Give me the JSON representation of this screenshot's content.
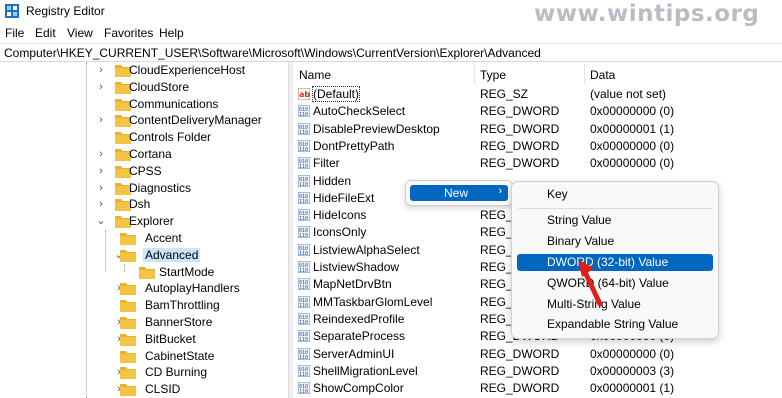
{
  "window": {
    "title": "Registry Editor",
    "watermark": "www.wintips.org",
    "icon": "registry-editor-icon"
  },
  "menu": [
    "File",
    "Edit",
    "View",
    "Favorites",
    "Help"
  ],
  "address": "Computer\\HKEY_CURRENT_USER\\Software\\Microsoft\\Windows\\CurrentVersion\\Explorer\\Advanced",
  "tree": [
    {
      "label": "CloudExperienceHost",
      "expander": "collapsed"
    },
    {
      "label": "CloudStore",
      "expander": "collapsed"
    },
    {
      "label": "Communications",
      "expander": "none"
    },
    {
      "label": "ContentDeliveryManager",
      "expander": "collapsed"
    },
    {
      "label": "Controls Folder",
      "expander": "none"
    },
    {
      "label": "Cortana",
      "expander": "collapsed"
    },
    {
      "label": "CPSS",
      "expander": "collapsed"
    },
    {
      "label": "Diagnostics",
      "expander": "collapsed"
    },
    {
      "label": "Dsh",
      "expander": "collapsed"
    },
    {
      "label": "Explorer",
      "expander": "expanded"
    },
    {
      "label": "Accent",
      "expander": "none"
    },
    {
      "label": "Advanced",
      "expander": "expanded",
      "selected": true
    },
    {
      "label": "StartMode",
      "expander": "none"
    },
    {
      "label": "AutoplayHandlers",
      "expander": "collapsed"
    },
    {
      "label": "BamThrottling",
      "expander": "none"
    },
    {
      "label": "BannerStore",
      "expander": "collapsed"
    },
    {
      "label": "BitBucket",
      "expander": "collapsed"
    },
    {
      "label": "CabinetState",
      "expander": "none"
    },
    {
      "label": "CD Burning",
      "expander": "collapsed"
    },
    {
      "label": "CLSID",
      "expander": "collapsed"
    }
  ],
  "list": {
    "headers": {
      "name": "Name",
      "type": "Type",
      "data": "Data"
    },
    "rows": [
      {
        "name": "(Default)",
        "type": "REG_SZ",
        "data": "(value not set)",
        "icon": "string-value-icon"
      },
      {
        "name": "AutoCheckSelect",
        "type": "REG_DWORD",
        "data": "0x00000000 (0)",
        "icon": "binary-value-icon"
      },
      {
        "name": "DisablePreviewDesktop",
        "type": "REG_DWORD",
        "data": "0x00000001 (1)",
        "icon": "binary-value-icon"
      },
      {
        "name": "DontPrettyPath",
        "type": "REG_DWORD",
        "data": "0x00000000 (0)",
        "icon": "binary-value-icon"
      },
      {
        "name": "Filter",
        "type": "REG_DWORD",
        "data": "0x00000000 (0)",
        "icon": "binary-value-icon"
      },
      {
        "name": "Hidden",
        "type": "",
        "data": "",
        "icon": "binary-value-icon"
      },
      {
        "name": "HideFileExt",
        "type": "",
        "data": "",
        "icon": "binary-value-icon"
      },
      {
        "name": "HideIcons",
        "type": "REG_DWORD",
        "data": "",
        "icon": "binary-value-icon"
      },
      {
        "name": "IconsOnly",
        "type": "REG_DWORD",
        "data": "",
        "icon": "binary-value-icon"
      },
      {
        "name": "ListviewAlphaSelect",
        "type": "REG_DWORD",
        "data": "",
        "icon": "binary-value-icon"
      },
      {
        "name": "ListviewShadow",
        "type": "REG_DWORD",
        "data": "",
        "icon": "binary-value-icon"
      },
      {
        "name": "MapNetDrvBtn",
        "type": "REG_DWORD",
        "data": "",
        "icon": "binary-value-icon"
      },
      {
        "name": "MMTaskbarGlomLevel",
        "type": "REG_DWORD",
        "data": "",
        "icon": "binary-value-icon"
      },
      {
        "name": "ReindexedProfile",
        "type": "REG_DWORD",
        "data": "",
        "icon": "binary-value-icon"
      },
      {
        "name": "SeparateProcess",
        "type": "REG_DWORD",
        "data": "0x00000000 (0)",
        "icon": "binary-value-icon"
      },
      {
        "name": "ServerAdminUI",
        "type": "REG_DWORD",
        "data": "0x00000000 (0)",
        "icon": "binary-value-icon"
      },
      {
        "name": "ShellMigrationLevel",
        "type": "REG_DWORD",
        "data": "0x00000003 (3)",
        "icon": "binary-value-icon"
      },
      {
        "name": "ShowCompColor",
        "type": "REG_DWORD",
        "data": "0x00000001 (1)",
        "icon": "binary-value-icon"
      }
    ]
  },
  "context_menu": {
    "new_label": "New",
    "submenu": [
      {
        "label": "Key"
      },
      {
        "separator": true
      },
      {
        "label": "String Value"
      },
      {
        "label": "Binary Value"
      },
      {
        "label": "DWORD (32-bit) Value",
        "highlighted": true
      },
      {
        "label": "QWORD (64-bit) Value"
      },
      {
        "label": "Multi-String Value"
      },
      {
        "label": "Expandable String Value"
      }
    ]
  },
  "colors": {
    "selection_blue": "#0067c0",
    "tree_selection": "#cce4f7",
    "folder_yellow": "#f3c443",
    "annotation_red": "#e11d1d"
  }
}
